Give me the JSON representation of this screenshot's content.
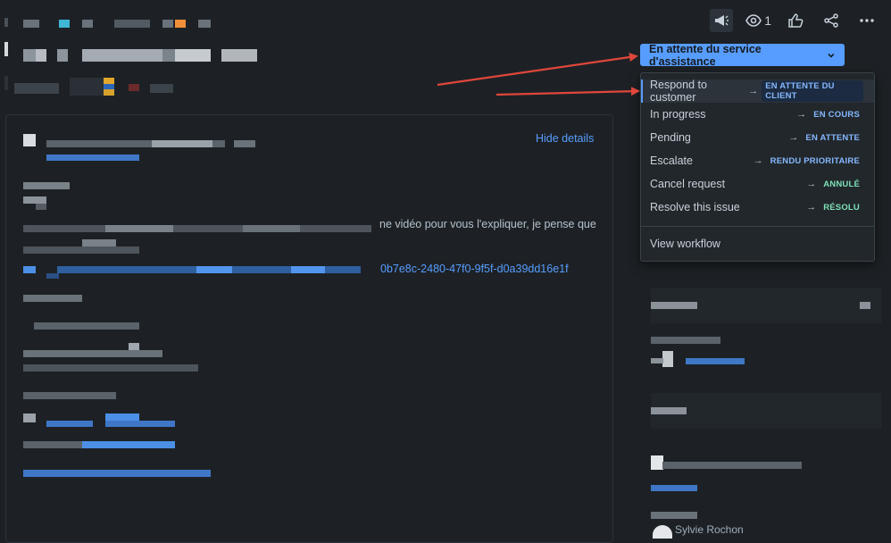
{
  "header": {
    "watch_count": "1",
    "icons": [
      "megaphone-icon",
      "eye-icon",
      "thumbs-up-icon",
      "share-icon",
      "more-icon"
    ]
  },
  "status_button": {
    "label": "En attente du service d'assistance",
    "color": "#579dff"
  },
  "status_menu": {
    "items": [
      {
        "label": "Respond to customer",
        "target": "EN ATTENTE DU CLIENT",
        "tone": "blue",
        "selected": true
      },
      {
        "label": "In progress",
        "target": "EN COURS",
        "tone": "blue"
      },
      {
        "label": "Pending",
        "target": "EN ATTENTE",
        "tone": "blue"
      },
      {
        "label": "Escalate",
        "target": "RENDU PRIORITAIRE",
        "tone": "blue"
      },
      {
        "label": "Cancel request",
        "target": "ANNULÉ",
        "tone": "green"
      },
      {
        "label": "Resolve this issue",
        "target": "RÉSOLU",
        "tone": "green"
      }
    ],
    "view_workflow": "View workflow"
  },
  "details": {
    "hide_label": "Hide details",
    "body_text": "ne vidéo pour vous l'expliquer, je pense que",
    "link_text": "0b7e8c-2480-47f0-9f5f-d0a39dd16e1f"
  },
  "sidebar": {
    "person_name": "Sylvie Rochon"
  },
  "colors": {
    "background": "#1d2125",
    "accent": "#579dff",
    "annotation_red": "#e0463a"
  }
}
